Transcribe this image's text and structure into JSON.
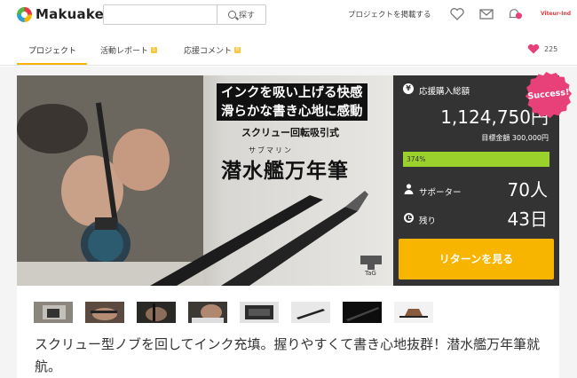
{
  "header": {
    "logo_text": "Makuake",
    "search_placeholder": "",
    "search_button": "探す",
    "post_project": "プロジェクトを掲載する",
    "avatar_label": "Viteur-Ind"
  },
  "tabs": [
    {
      "label": "プロジェクト",
      "badge": ""
    },
    {
      "label": "活動レポート",
      "badge": "1"
    },
    {
      "label": "応援コメント",
      "badge": "6"
    }
  ],
  "likes_count": "225",
  "hero": {
    "tagline_1": "インクを吸い上げる快感",
    "tagline_2": "滑らかな書き心地に感動",
    "subtitle": "スクリュー回転吸引式",
    "ruby": "サブマリン",
    "title": "潜水艦万年筆",
    "brand": "TaG"
  },
  "panel": {
    "funding_label": "応援購入総額",
    "amount": "1,124,750円",
    "goal": "目標金額 300,000円",
    "progress_text": "374%",
    "progress_fraction": 1.0,
    "supporters_label": "サポーター",
    "supporters_value": "70人",
    "remaining_label": "残り",
    "remaining_value": "43日",
    "return_button": "リターンを見る",
    "success_badge": "Success!"
  },
  "thumbnail_count": 8,
  "description": "スクリュー型ノブを回してインク充填。握りやすくて書き心地抜群！潜水艦万年筆就航。",
  "colors": {
    "accent": "#f7b500",
    "panel": "#333333",
    "progress": "#9ad12b",
    "badge": "#e8417a",
    "heart": "#e8417a"
  }
}
